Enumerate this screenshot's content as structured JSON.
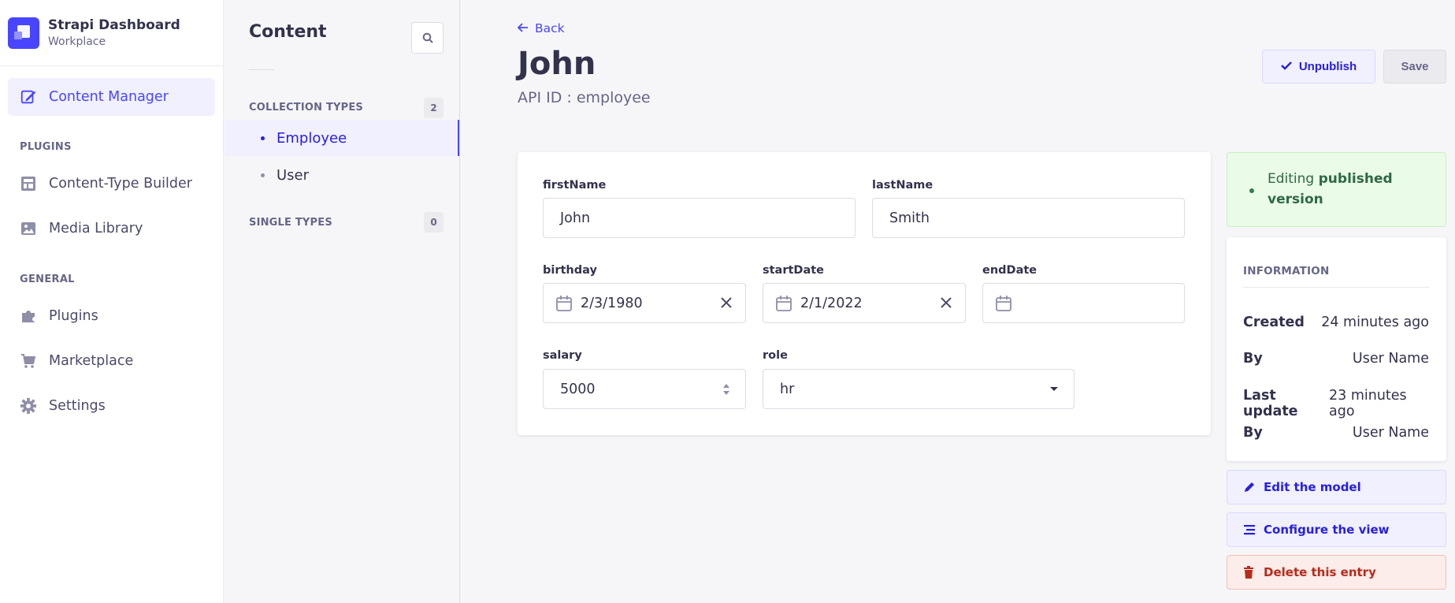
{
  "brand": {
    "title": "Strapi Dashboard",
    "subtitle": "Workplace",
    "accent": "#4945ff"
  },
  "mainnav": {
    "active": "Content Manager",
    "sections": {
      "plugins": "PLUGINS",
      "general": "GENERAL"
    },
    "items": [
      {
        "label": "Content Manager",
        "icon": "feather-icon"
      },
      {
        "label": "Content-Type Builder",
        "icon": "layout-icon"
      },
      {
        "label": "Media Library",
        "icon": "image-icon"
      },
      {
        "label": "Plugins",
        "icon": "puzzle-icon"
      },
      {
        "label": "Marketplace",
        "icon": "cart-icon"
      },
      {
        "label": "Settings",
        "icon": "gear-icon"
      }
    ]
  },
  "subnav": {
    "title": "Content",
    "collection": {
      "label": "COLLECTION TYPES",
      "count": "2",
      "items": [
        "Employee",
        "User"
      ]
    },
    "single": {
      "label": "SINGLE TYPES",
      "count": "0"
    }
  },
  "header": {
    "back": "Back",
    "title": "John",
    "subtitle": "API ID : employee",
    "unpublish": "Unpublish",
    "save": "Save"
  },
  "form": {
    "firstName": {
      "label": "firstName",
      "value": "John"
    },
    "lastName": {
      "label": "lastName",
      "value": "Smith"
    },
    "birthday": {
      "label": "birthday",
      "value": "2/3/1980"
    },
    "startDate": {
      "label": "startDate",
      "value": "2/1/2022"
    },
    "endDate": {
      "label": "endDate",
      "value": ""
    },
    "salary": {
      "label": "salary",
      "value": "5000"
    },
    "role": {
      "label": "role",
      "value": "hr"
    }
  },
  "status": {
    "prefix": "Editing ",
    "strong": "published version",
    "color": "#328048"
  },
  "information": {
    "title": "INFORMATION",
    "rows": [
      {
        "k": "Created",
        "v": "24 minutes ago"
      },
      {
        "k": "By",
        "v": "User Name"
      },
      {
        "k": "Last update",
        "v": "23 minutes ago"
      },
      {
        "k": "By",
        "v": "User Name"
      }
    ]
  },
  "actions": {
    "edit_model": "Edit the model",
    "configure_view": "Configure the view",
    "delete_entry": "Delete this entry"
  }
}
